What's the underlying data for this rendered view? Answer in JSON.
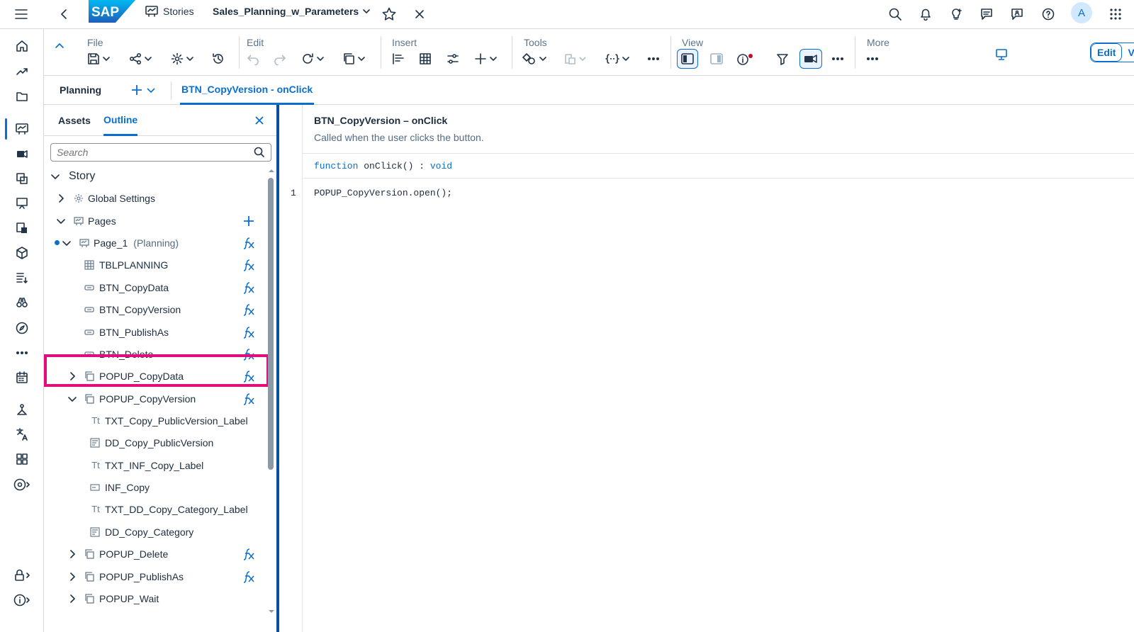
{
  "shell": {
    "stories_label": "Stories",
    "story_title": "Sales_Planning_w_Parameters",
    "avatar_initial": "A",
    "logo_text": "SAP"
  },
  "toolbar": {
    "file_label": "File",
    "edit_label": "Edit",
    "insert_label": "Insert",
    "tools_label": "Tools",
    "view_label": "View",
    "more_label": "More",
    "mode_edit": "Edit",
    "mode_view": "View"
  },
  "tabs": {
    "planning": "Planning",
    "script_tab": "BTN_CopyVersion - onClick"
  },
  "panel": {
    "tab_assets": "Assets",
    "tab_outline": "Outline",
    "search_placeholder": "Search",
    "tree": {
      "story": "Story",
      "global_settings": "Global Settings",
      "pages": "Pages",
      "page1": "Page_1",
      "page1_sub": "(Planning)",
      "tblplanning": "TBLPLANNING",
      "btn_copydata": "BTN_CopyData",
      "btn_copyversion": "BTN_CopyVersion",
      "btn_publishas": "BTN_PublishAs",
      "btn_delete": "BTN_Delete",
      "popup_copydata": "POPUP_CopyData",
      "popup_copyversion": "POPUP_CopyVersion",
      "txt_copy_publicversion_label": "TXT_Copy_PublicVersion_Label",
      "dd_copy_publicversion": "DD_Copy_PublicVersion",
      "txt_inf_copy_label": "TXT_INF_Copy_Label",
      "inf_copy": "INF_Copy",
      "txt_dd_copy_category_label": "TXT_DD_Copy_Category_Label",
      "dd_copy_category": "DD_Copy_Category",
      "popup_delete": "POPUP_Delete",
      "popup_publishas": "POPUP_PublishAs",
      "popup_wait": "POPUP_Wait"
    },
    "text_icon": "Tt"
  },
  "editor": {
    "title": "BTN_CopyVersion – onClick",
    "description": "Called when the user clicks the button.",
    "sig_keyword": "function",
    "sig_name": "onClick() :",
    "sig_type": "void",
    "line_number": "1",
    "code": "POPUP_CopyVersion.open();"
  },
  "colors": {
    "accent": "#0a6ed1",
    "highlight": "#e20e7d",
    "brand": "#0a6ed1"
  }
}
